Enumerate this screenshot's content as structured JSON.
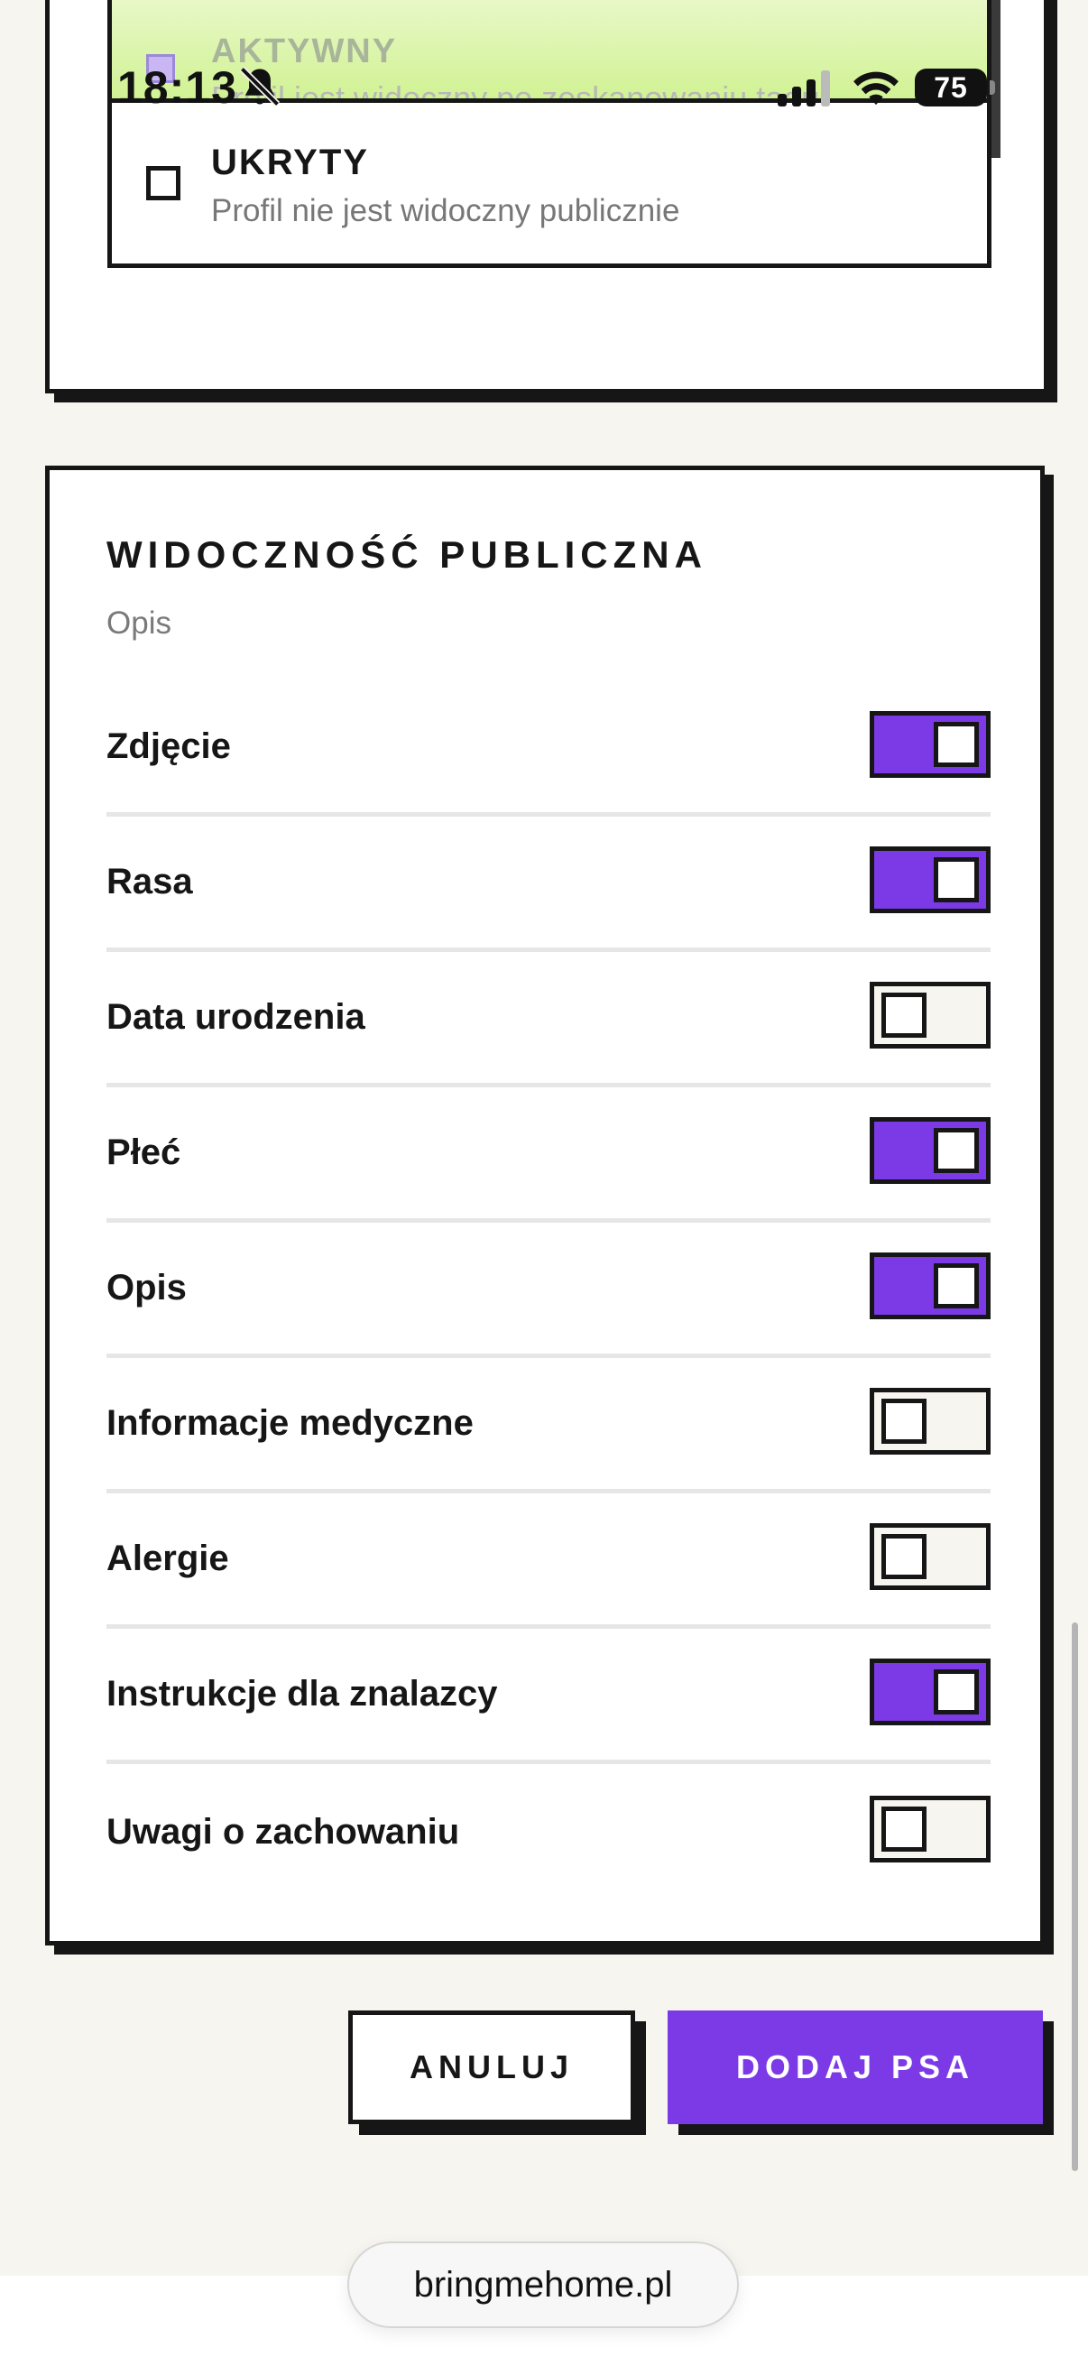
{
  "status_bar": {
    "time": "18:13",
    "battery": "75",
    "icons": [
      "bell-muted-icon",
      "cellular-signal-icon",
      "wifi-icon",
      "battery-icon"
    ]
  },
  "profile_status": {
    "active": {
      "title": "AKTYWNY",
      "description": "Profil jest widoczny po zeskanowaniu tagu",
      "visible_description": "Profil jest widoczny po zeskanowaniu tagu"
    },
    "hidden": {
      "title": "UKRYTY",
      "description": "Profil nie jest widoczny publicznie"
    }
  },
  "public_visibility": {
    "title": "WIDOCZNOŚĆ PUBLICZNA",
    "description": "Opis",
    "fields": [
      {
        "label": "Zdjęcie",
        "enabled": true
      },
      {
        "label": "Rasa",
        "enabled": true
      },
      {
        "label": "Data urodzenia",
        "enabled": false
      },
      {
        "label": "Płeć",
        "enabled": true
      },
      {
        "label": "Opis",
        "enabled": true
      },
      {
        "label": "Informacje medyczne",
        "enabled": false
      },
      {
        "label": "Alergie",
        "enabled": false
      },
      {
        "label": "Instrukcje dla znalazcy",
        "enabled": true
      },
      {
        "label": "Uwagi o zachowaniu",
        "enabled": false
      }
    ]
  },
  "actions": {
    "cancel_label": "ANULUJ",
    "submit_label": "DODAJ PSA"
  },
  "browser": {
    "url": "bringmehome.pl"
  },
  "colors": {
    "accent": "#7b3ae6",
    "ink": "#161616",
    "background": "#f7f5f0",
    "active_option_gradient_top": "#eef9d5",
    "active_option_gradient_bottom": "#c6f07c"
  }
}
